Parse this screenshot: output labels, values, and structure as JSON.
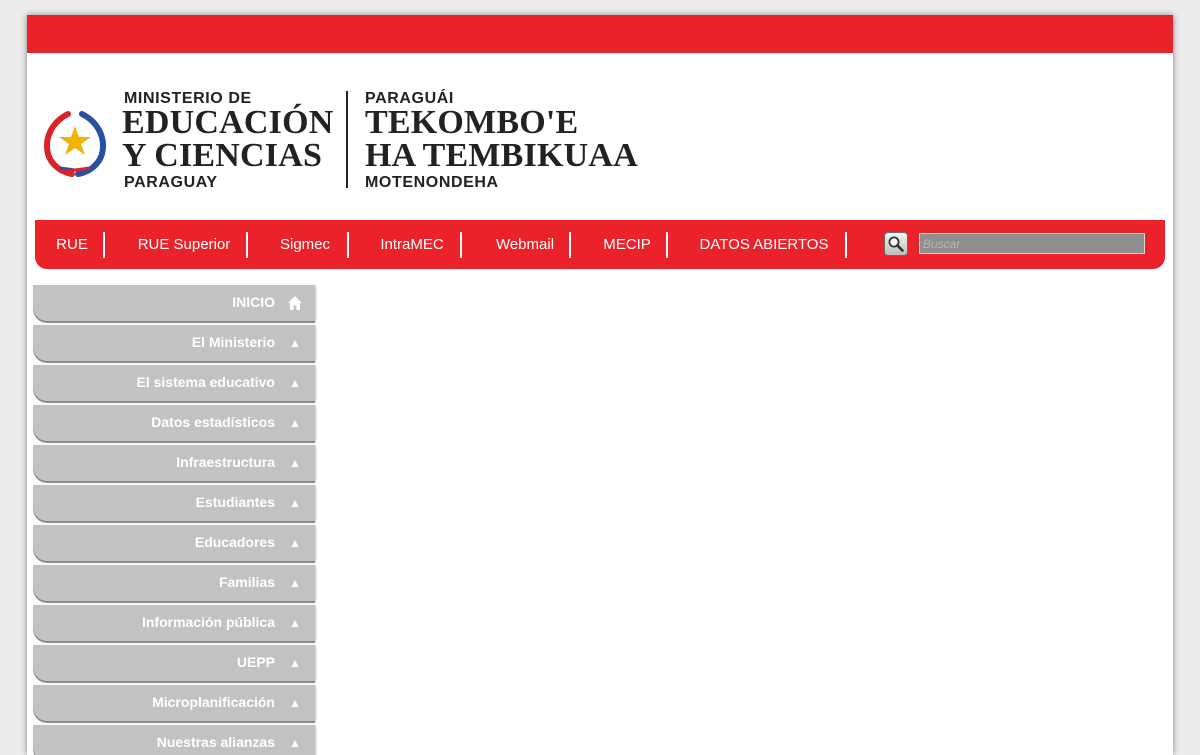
{
  "header": {
    "ministry": {
      "line1": "MINISTERIO DE",
      "line2": "EDUCACIÓN",
      "line3": "Y CIENCIAS",
      "line4": "PARAGUAY"
    },
    "motto": {
      "line1": "PARAGUÁI",
      "line2": "TEKOMBO'E",
      "line3": "HA TEMBIKUAA",
      "line4": "MOTENONDEHA"
    }
  },
  "nav": {
    "links": [
      {
        "label": "RUE"
      },
      {
        "label": "RUE Superior"
      },
      {
        "label": "Sigmec"
      },
      {
        "label": "IntraMEC"
      },
      {
        "label": "Webmail"
      },
      {
        "label": "MECIP"
      },
      {
        "label": "DATOS ABIERTOS"
      }
    ],
    "search": {
      "placeholder": "Buscar",
      "icon": "magnifier-icon"
    }
  },
  "sidebar": {
    "items": [
      {
        "label": "INICIO",
        "icon": "home-icon"
      },
      {
        "label": "El Ministerio",
        "icon": "triangle-up-icon"
      },
      {
        "label": "El sistema educativo",
        "icon": "triangle-up-icon"
      },
      {
        "label": "Datos estadísticos",
        "icon": "triangle-up-icon"
      },
      {
        "label": "Infraestructura",
        "icon": "triangle-up-icon"
      },
      {
        "label": "Estudiantes",
        "icon": "triangle-up-icon"
      },
      {
        "label": "Educadores",
        "icon": "triangle-up-icon"
      },
      {
        "label": "Familias",
        "icon": "triangle-up-icon"
      },
      {
        "label": "Información pública",
        "icon": "triangle-up-icon"
      },
      {
        "label": "UEPP",
        "icon": "triangle-up-icon"
      },
      {
        "label": "Microplanificación",
        "icon": "triangle-up-icon"
      },
      {
        "label": "Nuestras alianzas",
        "icon": "triangle-up-icon"
      }
    ]
  },
  "colors": {
    "brand_red": "#ea232b",
    "sidebar_gray": "#c2c2c2",
    "logo_blue": "#2b4fa0",
    "logo_gold": "#f2b200"
  }
}
